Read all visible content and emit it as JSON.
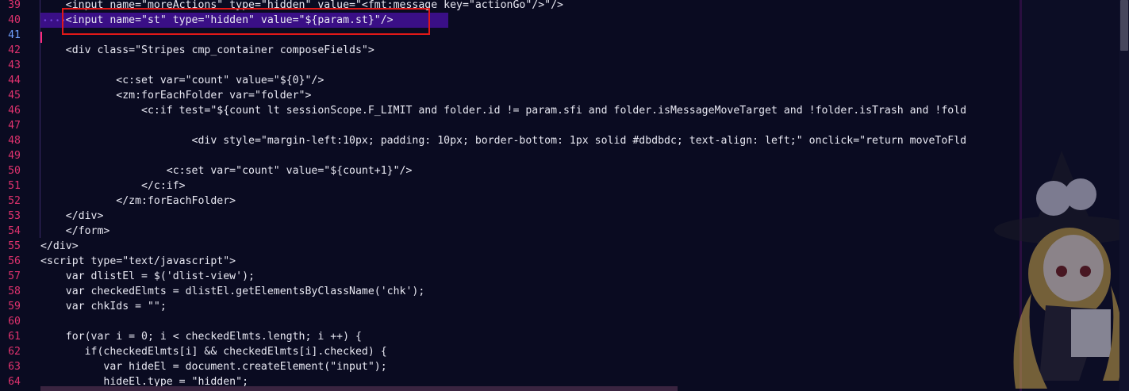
{
  "editor": {
    "lines": [
      {
        "number": "39",
        "text": "    <input name=\"moreActions\" type=\"hidden\" value=\"<fmt:message key=\"actionGo\"/>\"/>"
      },
      {
        "number": "40",
        "text": "    <input name=\"st\" type=\"hidden\" value=\"${param.st}\"/>"
      },
      {
        "number": "41",
        "text": ""
      },
      {
        "number": "42",
        "text": "    <div class=\"Stripes cmp_container composeFields\">"
      },
      {
        "number": "43",
        "text": ""
      },
      {
        "number": "44",
        "text": "            <c:set var=\"count\" value=\"${0}\"/>"
      },
      {
        "number": "45",
        "text": "            <zm:forEachFolder var=\"folder\">"
      },
      {
        "number": "46",
        "text": "                <c:if test=\"${count lt sessionScope.F_LIMIT and folder.id != param.sfi and folder.isMessageMoveTarget and !folder.isTrash and !fold"
      },
      {
        "number": "47",
        "text": ""
      },
      {
        "number": "48",
        "text": "                        <div style=\"margin-left:10px; padding: 10px; border-bottom: 1px solid #dbdbdc; text-align: left;\" onclick=\"return moveToFld"
      },
      {
        "number": "49",
        "text": ""
      },
      {
        "number": "50",
        "text": "                    <c:set var=\"count\" value=\"${count+1}\"/>"
      },
      {
        "number": "51",
        "text": "                </c:if>"
      },
      {
        "number": "52",
        "text": "            </zm:forEachFolder>"
      },
      {
        "number": "53",
        "text": "    </div>"
      },
      {
        "number": "54",
        "text": "    </form>"
      },
      {
        "number": "55",
        "text": "</div>"
      },
      {
        "number": "56",
        "text": "<script type=\"text/javascript\">"
      },
      {
        "number": "57",
        "text": "    var dlistEl = $('dlist-view');"
      },
      {
        "number": "58",
        "text": "    var checkedElmts = dlistEl.getElementsByClassName('chk');"
      },
      {
        "number": "59",
        "text": "    var chkIds = \"\";"
      },
      {
        "number": "60",
        "text": ""
      },
      {
        "number": "61",
        "text": "    for(var i = 0; i < checkedElmts.length; i ++) {"
      },
      {
        "number": "62",
        "text": "       if(checkedElmts[i] && checkedElmts[i].checked) {"
      },
      {
        "number": "63",
        "text": "          var hideEl = document.createElement(\"input\");"
      },
      {
        "number": "64",
        "text": "          hideEl.type = \"hidden\";"
      }
    ],
    "current_line": "41",
    "highlighted_line": "40"
  },
  "colors": {
    "background": "#0a0b21",
    "line_number": "#e0326e",
    "current_line_number": "#6fa0ff",
    "highlight_band": "#3a0f86",
    "annotation_box": "#e01818"
  },
  "icons": {
    "mascot": "anime-witch-mascot"
  }
}
